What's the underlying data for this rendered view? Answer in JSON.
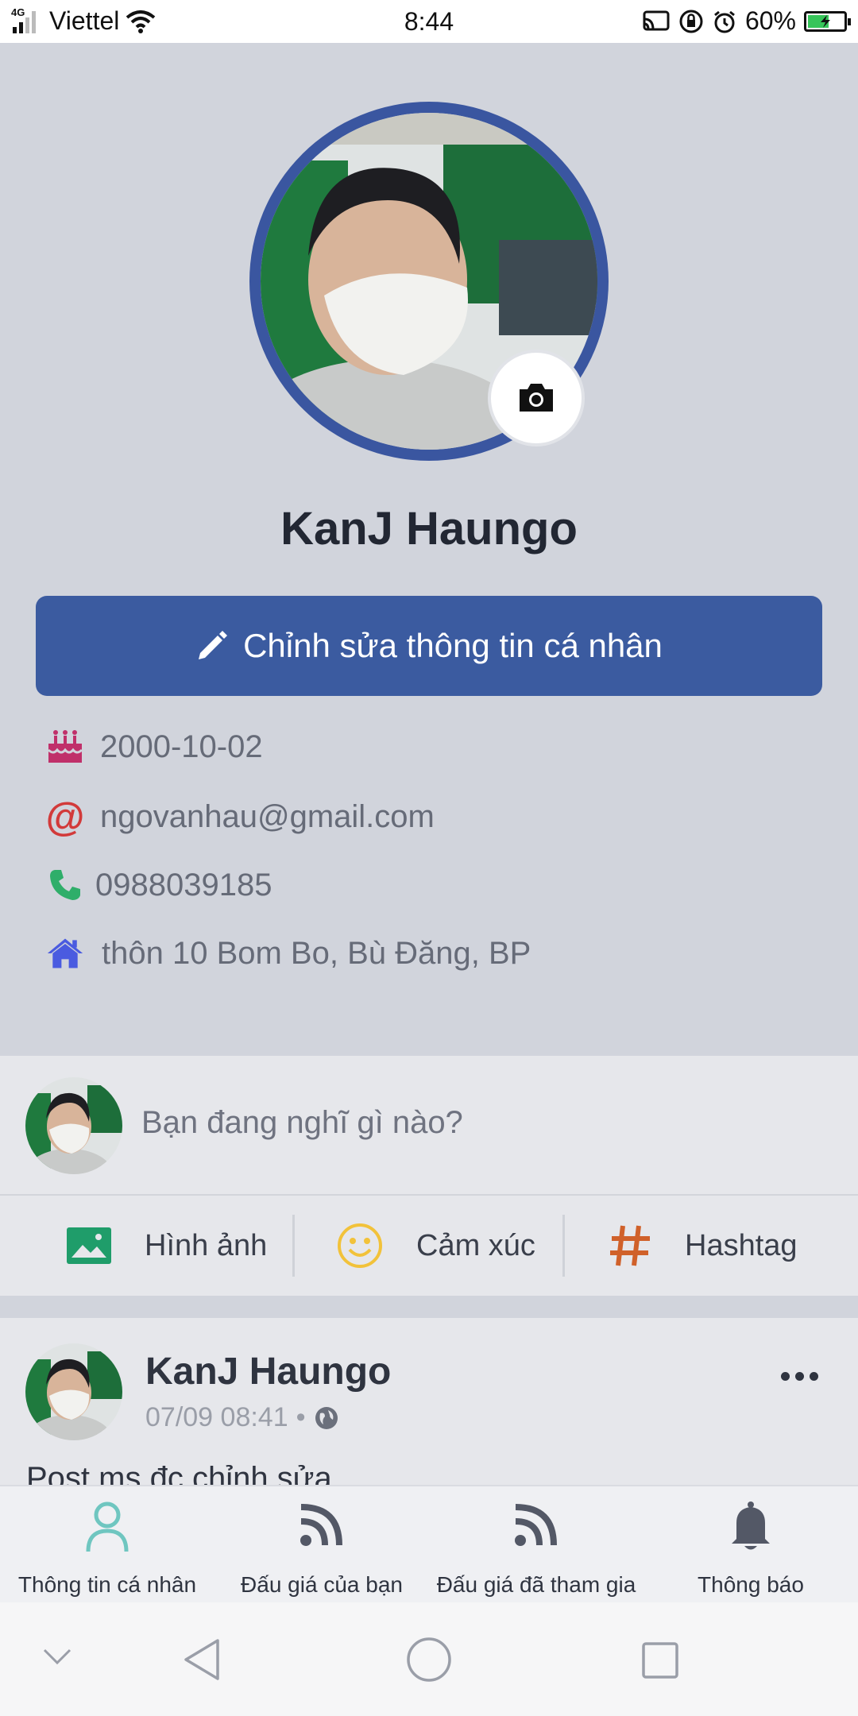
{
  "status_bar": {
    "network_tag": "4G",
    "carrier": "Viettel",
    "time": "8:44",
    "battery": "60%",
    "battery_level": 0.6
  },
  "profile": {
    "name": "KanJ Haungo",
    "edit_button_label": "Chỉnh sửa thông tin cá nhân",
    "info": {
      "birthday": "2000-10-02",
      "email": "ngovanhau@gmail.com",
      "phone": "0988039185",
      "address": "thôn 10 Bom Bo, Bù Đăng, BP"
    }
  },
  "composer": {
    "prompt": "Bạn đang nghĩ gì nào?",
    "actions": [
      {
        "label": "Hình ảnh",
        "icon": "image-icon"
      },
      {
        "label": "Cảm xúc",
        "icon": "smiley-icon"
      },
      {
        "label": "Hashtag",
        "icon": "hashtag-icon"
      }
    ]
  },
  "post": {
    "author": "KanJ Haungo",
    "time": "07/09 08:41",
    "separator": "•",
    "text": "Post ms đc chỉnh sửa"
  },
  "bottom_nav": {
    "items": [
      {
        "label": "Thông tin cá nhân",
        "icon": "user-icon",
        "active": true
      },
      {
        "label": "Đấu giá của bạn",
        "icon": "rss-icon",
        "active": false
      },
      {
        "label": "Đấu giá đã tham gia",
        "icon": "rss-icon",
        "active": false
      },
      {
        "label": "Thông báo",
        "icon": "bell-icon",
        "active": false
      }
    ]
  },
  "colors": {
    "primary": "#3b5ba0",
    "active_nav": "#6fc6c0",
    "birthday_icon": "#c0306a",
    "email_icon": "#d23a3a",
    "phone_icon": "#2fae6a",
    "home_icon": "#4a5be0",
    "image_icon": "#1f9d6a",
    "smiley_icon": "#f2c23a",
    "hashtag_icon": "#d0612a"
  }
}
